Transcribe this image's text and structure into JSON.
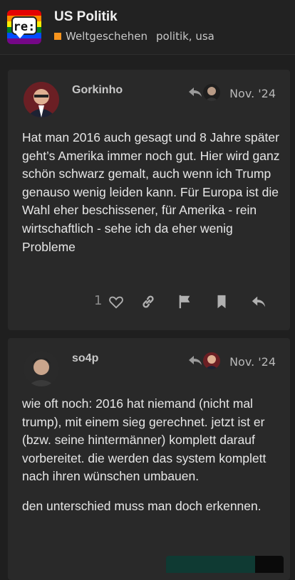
{
  "header": {
    "logo_text": "re:",
    "title": "US Politik",
    "category": "Weltgeschehen",
    "tags": "politik, usa",
    "category_color": "#f7941d"
  },
  "posts": [
    {
      "username": "Gorkinho",
      "date": "Nov. '24",
      "paragraphs": [
        "Hat man 2016 auch gesagt und 8 Jahre später geht’s Amerika immer noch gut. Hier wird ganz schön schwarz gemalt, auch wenn ich Trump genauso wenig leiden kann. Für Europa ist die Wahl eher beschissener, für Amerika - rein wirtschaftlich - sehe ich da eher wenig Probleme"
      ],
      "like_count": "1",
      "actions": [
        "heart-icon",
        "link-icon",
        "flag-icon",
        "bookmark-icon",
        "reply-icon"
      ]
    },
    {
      "username": "so4p",
      "date": "Nov. '24",
      "paragraphs": [
        "wie oft noch: 2016 hat niemand (nicht mal trump), mit einem sieg gerechnet. jetzt ist er (bzw. seine hintermänner) komplett darauf vorbereitet. die werden das system komplett nach ihren wünschen umbauen.",
        "den unterschied muss man doch erkennen."
      ]
    }
  ]
}
